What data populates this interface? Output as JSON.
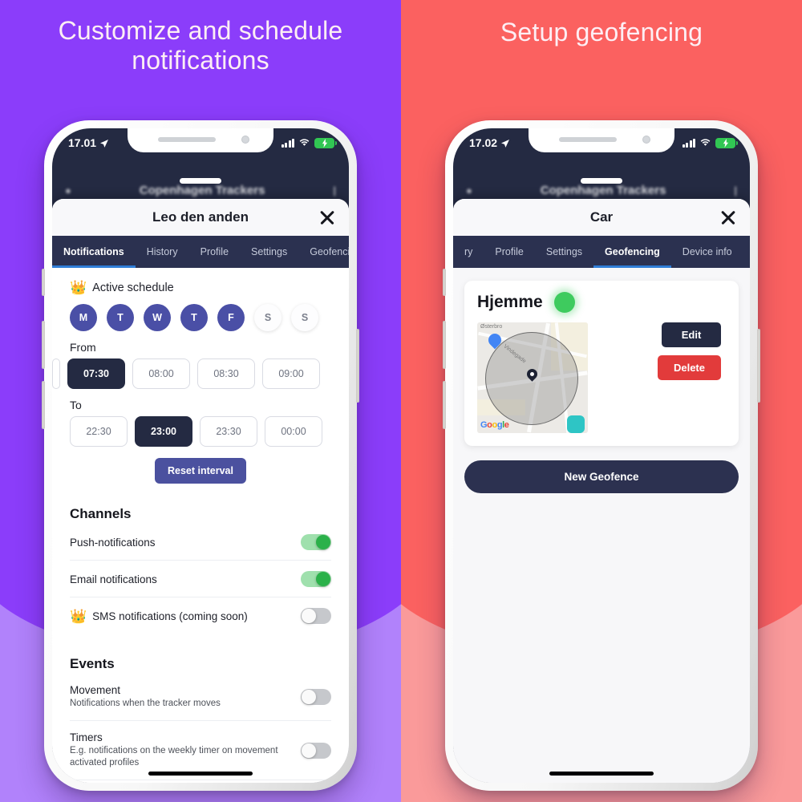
{
  "panels": {
    "left": {
      "headline": "Customize and schedule notifications",
      "bg": "#8b3dfa",
      "bg_light": "#b182fb"
    },
    "right": {
      "headline": "Setup geofencing",
      "bg": "#fb6160",
      "bg_light": "#fa9a9a"
    }
  },
  "phone_left": {
    "status": {
      "time": "17.01",
      "location_icon": "location-arrow-icon",
      "signal_icon": "cellular-bars-icon",
      "wifi_icon": "wifi-icon",
      "battery_icon": "battery-charging-icon"
    },
    "behind_app": {
      "search_icon": "search-icon",
      "title": "Copenhagen Trackers",
      "menu_icon": "menu-icon"
    },
    "sheet": {
      "title": "Leo den anden",
      "close_icon": "close-icon",
      "tabs": [
        {
          "label": "Notifications",
          "active": true
        },
        {
          "label": "History",
          "active": false
        },
        {
          "label": "Profile",
          "active": false
        },
        {
          "label": "Settings",
          "active": false
        },
        {
          "label": "Geofencing",
          "active": false
        }
      ],
      "schedule": {
        "crown_icon": "crown-icon",
        "label": "Active schedule",
        "days": [
          {
            "letter": "M",
            "selected": true
          },
          {
            "letter": "T",
            "selected": true
          },
          {
            "letter": "W",
            "selected": true
          },
          {
            "letter": "T",
            "selected": true
          },
          {
            "letter": "F",
            "selected": true
          },
          {
            "letter": "S",
            "selected": false
          },
          {
            "letter": "S",
            "selected": false
          }
        ],
        "from_label": "From",
        "from_times": [
          {
            "value": "07:30",
            "selected": true
          },
          {
            "value": "08:00",
            "selected": false
          },
          {
            "value": "08:30",
            "selected": false
          },
          {
            "value": "09:00",
            "selected": false
          }
        ],
        "to_label": "To",
        "to_times": [
          {
            "value": "22:30",
            "selected": false
          },
          {
            "value": "23:00",
            "selected": true
          },
          {
            "value": "23:30",
            "selected": false
          },
          {
            "value": "00:00",
            "selected": false
          }
        ],
        "reset_label": "Reset interval"
      },
      "channels": {
        "title": "Channels",
        "items": [
          {
            "label": "Push-notifications",
            "on": true,
            "crown": false
          },
          {
            "label": "Email notifications",
            "on": true,
            "crown": false
          },
          {
            "label": "SMS notifications (coming soon)",
            "on": false,
            "crown": true
          }
        ]
      },
      "events": {
        "title": "Events",
        "items": [
          {
            "label": "Movement",
            "sub": "Notifications when the tracker moves",
            "on": false
          },
          {
            "label": "Timers",
            "sub": "E.g. notifications on the weekly timer on movement activated profiles",
            "on": false
          }
        ]
      }
    }
  },
  "phone_right": {
    "status": {
      "time": "17.02",
      "location_icon": "location-arrow-icon",
      "signal_icon": "cellular-bars-icon",
      "wifi_icon": "wifi-icon",
      "battery_icon": "battery-charging-icon"
    },
    "behind_app": {
      "search_icon": "search-icon",
      "title": "Copenhagen Trackers",
      "menu_icon": "menu-icon"
    },
    "sheet": {
      "title": "Car",
      "close_icon": "close-icon",
      "tabs": [
        {
          "label": "ry",
          "active": false
        },
        {
          "label": "Profile",
          "active": false
        },
        {
          "label": "Settings",
          "active": false
        },
        {
          "label": "Geofencing",
          "active": true
        },
        {
          "label": "Device info",
          "active": false
        }
      ],
      "geofence": {
        "name": "Hjemme",
        "status_dot_color": "#3ecb5e",
        "map": {
          "provider_label": [
            "G",
            "o",
            "o",
            "g",
            "l",
            "e"
          ],
          "streets": [
            "Østerbro",
            "Vindegade",
            "indergade"
          ],
          "pin_icon": "map-pin-icon",
          "shop_icon": "shop-pin-icon"
        },
        "edit_label": "Edit",
        "delete_label": "Delete"
      },
      "new_geofence_label": "New Geofence"
    }
  }
}
